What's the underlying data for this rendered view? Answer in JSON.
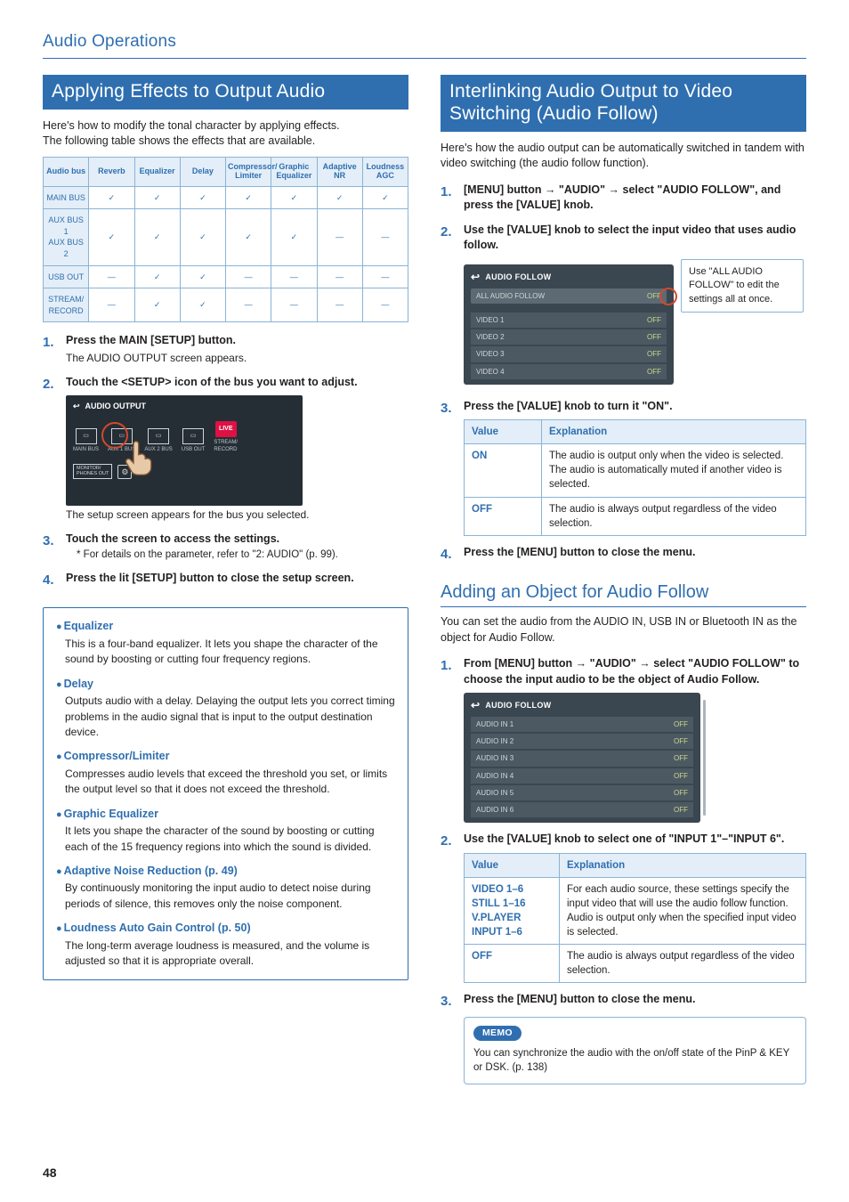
{
  "header": {
    "section": "Audio Operations",
    "page_number": "48"
  },
  "left": {
    "title": "Applying Effects to Output Audio",
    "intro1": "Here's how to modify the tonal character by applying effects.",
    "intro2": "The following table shows the effects that are available.",
    "effects_table": {
      "header": [
        "Audio bus",
        "Reverb",
        "Equalizer",
        "Delay",
        "Compressor/\nLimiter",
        "Graphic\nEqualizer",
        "Adaptive\nNR",
        "Loudness\nAGC"
      ],
      "rows": [
        {
          "label": "MAIN BUS",
          "cells": [
            "✓",
            "✓",
            "✓",
            "✓",
            "✓",
            "✓",
            "✓"
          ]
        },
        {
          "label": "AUX BUS 1\nAUX BUS 2",
          "cells": [
            "✓",
            "✓",
            "✓",
            "✓",
            "✓",
            "—",
            "—"
          ]
        },
        {
          "label": "USB OUT",
          "cells": [
            "—",
            "✓",
            "✓",
            "—",
            "—",
            "—",
            "—"
          ]
        },
        {
          "label": "STREAM/\nRECORD",
          "cells": [
            "—",
            "✓",
            "✓",
            "—",
            "—",
            "—",
            "—"
          ]
        }
      ]
    },
    "steps": [
      {
        "title": "Press the MAIN [SETUP] button.",
        "note": "The AUDIO OUTPUT screen appears."
      },
      {
        "title": "Touch the <SETUP> icon of the bus you want to adjust.",
        "note": "The setup screen appears for the bus you selected.",
        "screen": "audio_output"
      },
      {
        "title": "Touch the screen to access the settings.",
        "ast": "For details on the parameter, refer to \"2: AUDIO\" (p. 99)."
      },
      {
        "title": "Press the lit [SETUP] button to close the setup screen."
      }
    ],
    "audio_output_screen": {
      "header": "AUDIO OUTPUT",
      "tiles": [
        {
          "label": "MAIN BUS"
        },
        {
          "label": "AUX 1 BUS"
        },
        {
          "label": "AUX 2 BUS"
        },
        {
          "label": "USB OUT"
        },
        {
          "label": "STREAM/\nRECORD",
          "live": "LIVE"
        }
      ],
      "monitor": "MONITOR/\nPHONES OUT"
    },
    "bullets": [
      {
        "h": "Equalizer",
        "p": "This is a four-band equalizer. It lets you shape the character of the sound by boosting or cutting four frequency regions."
      },
      {
        "h": "Delay",
        "p": "Outputs audio with a delay. Delaying the output lets you correct timing problems in the audio signal that is input to the output destination device."
      },
      {
        "h": "Compressor/Limiter",
        "p": "Compresses audio levels that exceed the threshold you set, or limits the output level so that it does not exceed the threshold."
      },
      {
        "h": "Graphic Equalizer",
        "p": "It lets you shape the character of the sound by boosting or cutting each of the 15 frequency regions into which the sound is divided."
      },
      {
        "h": "Adaptive Noise Reduction (p. 49)",
        "p": "By continuously monitoring the input audio to detect noise during periods of silence, this removes only the noise component."
      },
      {
        "h": "Loudness Auto Gain Control (p. 50)",
        "p": "The long-term average loudness is measured, and the volume is adjusted so that it is appropriate overall."
      }
    ]
  },
  "right": {
    "title": "Interlinking Audio Output to Video Switching (Audio Follow)",
    "intro": "Here's how the audio output can be automatically switched in tandem with video switching (the audio follow function).",
    "steps_a": [
      {
        "title": "[MENU] button → \"AUDIO\" → select \"AUDIO FOLLOW\", and press the [VALUE] knob."
      },
      {
        "title": "Use the [VALUE] knob to select the input video that uses audio follow."
      },
      {
        "title": "Press the [VALUE] knob to turn it \"ON\".",
        "table": true
      },
      {
        "title": "Press the [MENU] button to close the menu."
      }
    ],
    "af_screen": {
      "header": "AUDIO FOLLOW",
      "top": {
        "l": "ALL AUDIO FOLLOW",
        "r": "OFF"
      },
      "rows": [
        {
          "l": "VIDEO 1",
          "r": "OFF"
        },
        {
          "l": "VIDEO 2",
          "r": "OFF"
        },
        {
          "l": "VIDEO 3",
          "r": "OFF"
        },
        {
          "l": "VIDEO 4",
          "r": "OFF"
        }
      ]
    },
    "callout": "Use \"ALL AUDIO FOLLOW\" to edit the settings all at once.",
    "val_table_a": {
      "head": [
        "Value",
        "Explanation"
      ],
      "rows": [
        {
          "v": "ON",
          "e": "The audio is output only when the video is selected. The audio is automatically muted if another video is selected."
        },
        {
          "v": "OFF",
          "e": "The audio is always output regardless of the video selection."
        }
      ]
    },
    "sub_title": "Adding an Object for Audio Follow",
    "sub_intro": "You can set the audio from the AUDIO IN, USB IN or Bluetooth IN as the object for Audio Follow.",
    "steps_b": [
      {
        "title": "From [MENU] button → \"AUDIO\" → select \"AUDIO FOLLOW\" to choose the input audio to be the object of Audio Follow."
      },
      {
        "title": "Use the [VALUE] knob to select one of \"INPUT 1\"–\"INPUT 6\"."
      },
      {
        "title": "Press the [MENU] button to close the menu."
      }
    ],
    "af_screen_b": {
      "header": "AUDIO FOLLOW",
      "rows": [
        {
          "l": "AUDIO IN 1",
          "r": "OFF"
        },
        {
          "l": "AUDIO IN 2",
          "r": "OFF"
        },
        {
          "l": "AUDIO IN 3",
          "r": "OFF"
        },
        {
          "l": "AUDIO IN 4",
          "r": "OFF"
        },
        {
          "l": "AUDIO IN 5",
          "r": "OFF"
        },
        {
          "l": "AUDIO IN 6",
          "r": "OFF"
        }
      ]
    },
    "val_table_b": {
      "head": [
        "Value",
        "Explanation"
      ],
      "rows": [
        {
          "v": "VIDEO 1–6\nSTILL 1–16\nV.PLAYER\nINPUT 1–6",
          "e": "For each audio source, these settings specify the input video that will use the audio follow function. Audio is output only when the specified input video is selected."
        },
        {
          "v": "OFF",
          "e": "The audio is always output regardless of the video selection."
        }
      ]
    },
    "memo": {
      "tag": "MEMO",
      "text": "You can synchronize the audio with the on/off state of the PinP & KEY or DSK. (p. 138)"
    }
  }
}
